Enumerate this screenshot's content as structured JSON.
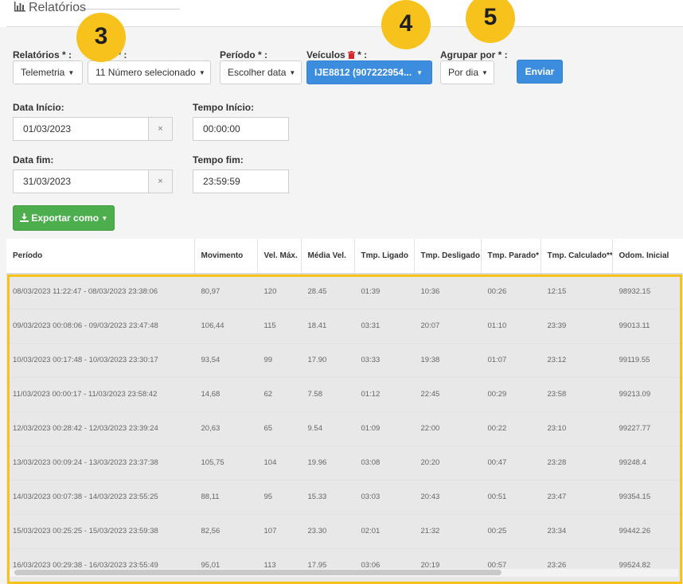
{
  "page": {
    "title": "Relatórios"
  },
  "filters": {
    "relatorios": {
      "label": "Relatórios * :",
      "value": "Telemetria"
    },
    "itens": {
      "label": "os * :",
      "value": "11 Número selecionado"
    },
    "periodo": {
      "label": "Período * :",
      "value": "Escolher data"
    },
    "veiculos": {
      "label_a": "Veículos",
      "label_b": "* :",
      "value": "IJE8812 (907222954..."
    },
    "agrupar": {
      "label": "Agrupar por * :",
      "value": "Por dia"
    },
    "enviar": "Enviar"
  },
  "dates": {
    "inicio_label": "Data Início:",
    "inicio_value": "01/03/2023",
    "tempo_inicio_label": "Tempo Início:",
    "tempo_inicio_value": "00:00:00",
    "fim_label": "Data fim:",
    "fim_value": "31/03/2023",
    "tempo_fim_label": "Tempo fim:",
    "tempo_fim_value": "23:59:59",
    "clear_glyph": "×"
  },
  "export": {
    "label": "Exportar como"
  },
  "badges": [
    "3",
    "4",
    "5"
  ],
  "colors": {
    "badge": "#f7c21c",
    "primary": "#3c8dde",
    "success": "#4cae4c",
    "trash": "#d9262c"
  },
  "table": {
    "columns": [
      "Período",
      "Movimento",
      "Vel. Máx.",
      "Média Vel.",
      "Tmp. Ligado",
      "Tmp. Desligado",
      "Tmp. Parado*",
      "Tmp. Calculado**",
      "Odom. Inicial"
    ],
    "rows": [
      [
        "08/03/2023 11:22:47 - 08/03/2023 23:38:06",
        "80,97",
        "120",
        "28.45",
        "01:39",
        "10:36",
        "00:26",
        "12:15",
        "98932.15"
      ],
      [
        "09/03/2023 00:08:06 - 09/03/2023 23:47:48",
        "106,44",
        "115",
        "18.41",
        "03:31",
        "20:07",
        "01:10",
        "23:39",
        "99013.11"
      ],
      [
        "10/03/2023 00:17:48 - 10/03/2023 23:30:17",
        "93,54",
        "99",
        "17.90",
        "03:33",
        "19:38",
        "01:07",
        "23:12",
        "99119.55"
      ],
      [
        "11/03/2023 00:00:17 - 11/03/2023 23:58:42",
        "14,68",
        "62",
        "7.58",
        "01:12",
        "22:45",
        "00:29",
        "23:58",
        "99213.09"
      ],
      [
        "12/03/2023 00:28:42 - 12/03/2023 23:39:24",
        "20,63",
        "65",
        "9.54",
        "01:09",
        "22:00",
        "00:22",
        "23:10",
        "99227.77"
      ],
      [
        "13/03/2023 00:09:24 - 13/03/2023 23:37:38",
        "105,75",
        "104",
        "19.96",
        "03:08",
        "20:20",
        "00:47",
        "23:28",
        "99248.4"
      ],
      [
        "14/03/2023 00:07:38 - 14/03/2023 23:55:25",
        "88,11",
        "95",
        "15.33",
        "03:03",
        "20:43",
        "00:51",
        "23:47",
        "99354.15"
      ],
      [
        "15/03/2023 00:25:25 - 15/03/2023 23:59:38",
        "82,56",
        "107",
        "23.30",
        "02:01",
        "21:32",
        "00:25",
        "23:34",
        "99442.26"
      ],
      [
        "16/03/2023 00:29:38 - 16/03/2023 23:55:49",
        "95,01",
        "113",
        "17.95",
        "03:06",
        "20:19",
        "00:57",
        "23:26",
        "99524.82"
      ]
    ]
  }
}
